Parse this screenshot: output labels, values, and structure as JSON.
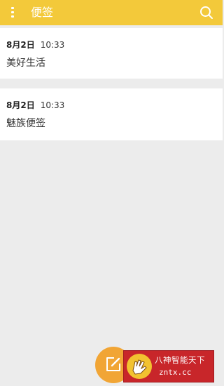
{
  "header": {
    "title": "便签",
    "menu_icon": "more-vertical-icon",
    "search_icon": "search-icon",
    "background_color": "#f3c93a"
  },
  "notes": [
    {
      "date": "8月2日",
      "time": "10:33",
      "text": "美好生活"
    },
    {
      "date": "8月2日",
      "time": "10:33",
      "text": "魅族便签"
    }
  ],
  "fab": {
    "icon": "edit-icon",
    "color": "#f1a535"
  },
  "watermark": {
    "title": "八神智能天下",
    "url": "zntx.cc",
    "color": "#c8262a"
  }
}
